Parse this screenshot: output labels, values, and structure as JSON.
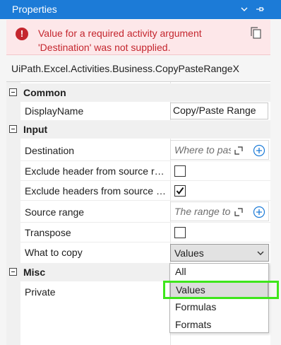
{
  "window": {
    "title": "Properties"
  },
  "error": {
    "message": "Value for a required activity argument 'Destination' was not supplied."
  },
  "activity_class": "UiPath.Excel.Activities.Business.CopyPasteRangeX",
  "categories": {
    "common": {
      "label": "Common"
    },
    "input": {
      "label": "Input"
    },
    "misc": {
      "label": "Misc"
    }
  },
  "properties": {
    "display_name": {
      "label": "DisplayName",
      "value": "Copy/Paste Range"
    },
    "destination": {
      "label": "Destination",
      "placeholder": "Where to paste"
    },
    "exclude_header_source": {
      "label": "Exclude header from source range",
      "checked": false
    },
    "exclude_headers_source_range": {
      "label": "Exclude headers from source range",
      "checked": true
    },
    "source_range": {
      "label": "Source range",
      "placeholder": "The range to copy"
    },
    "transpose": {
      "label": "Transpose",
      "checked": false
    },
    "what_to_copy": {
      "label": "What to copy",
      "value": "Values"
    },
    "private": {
      "label": "Private"
    }
  },
  "dropdown": {
    "options": [
      "All",
      "Values",
      "Formulas",
      "Formats"
    ],
    "selected": "Values"
  },
  "colors": {
    "titlebar": "#1c7bd7",
    "error_text": "#c4262e",
    "error_bg": "#fde7e9",
    "highlight": "#3ee61b",
    "accent": "#1c7bd7"
  }
}
